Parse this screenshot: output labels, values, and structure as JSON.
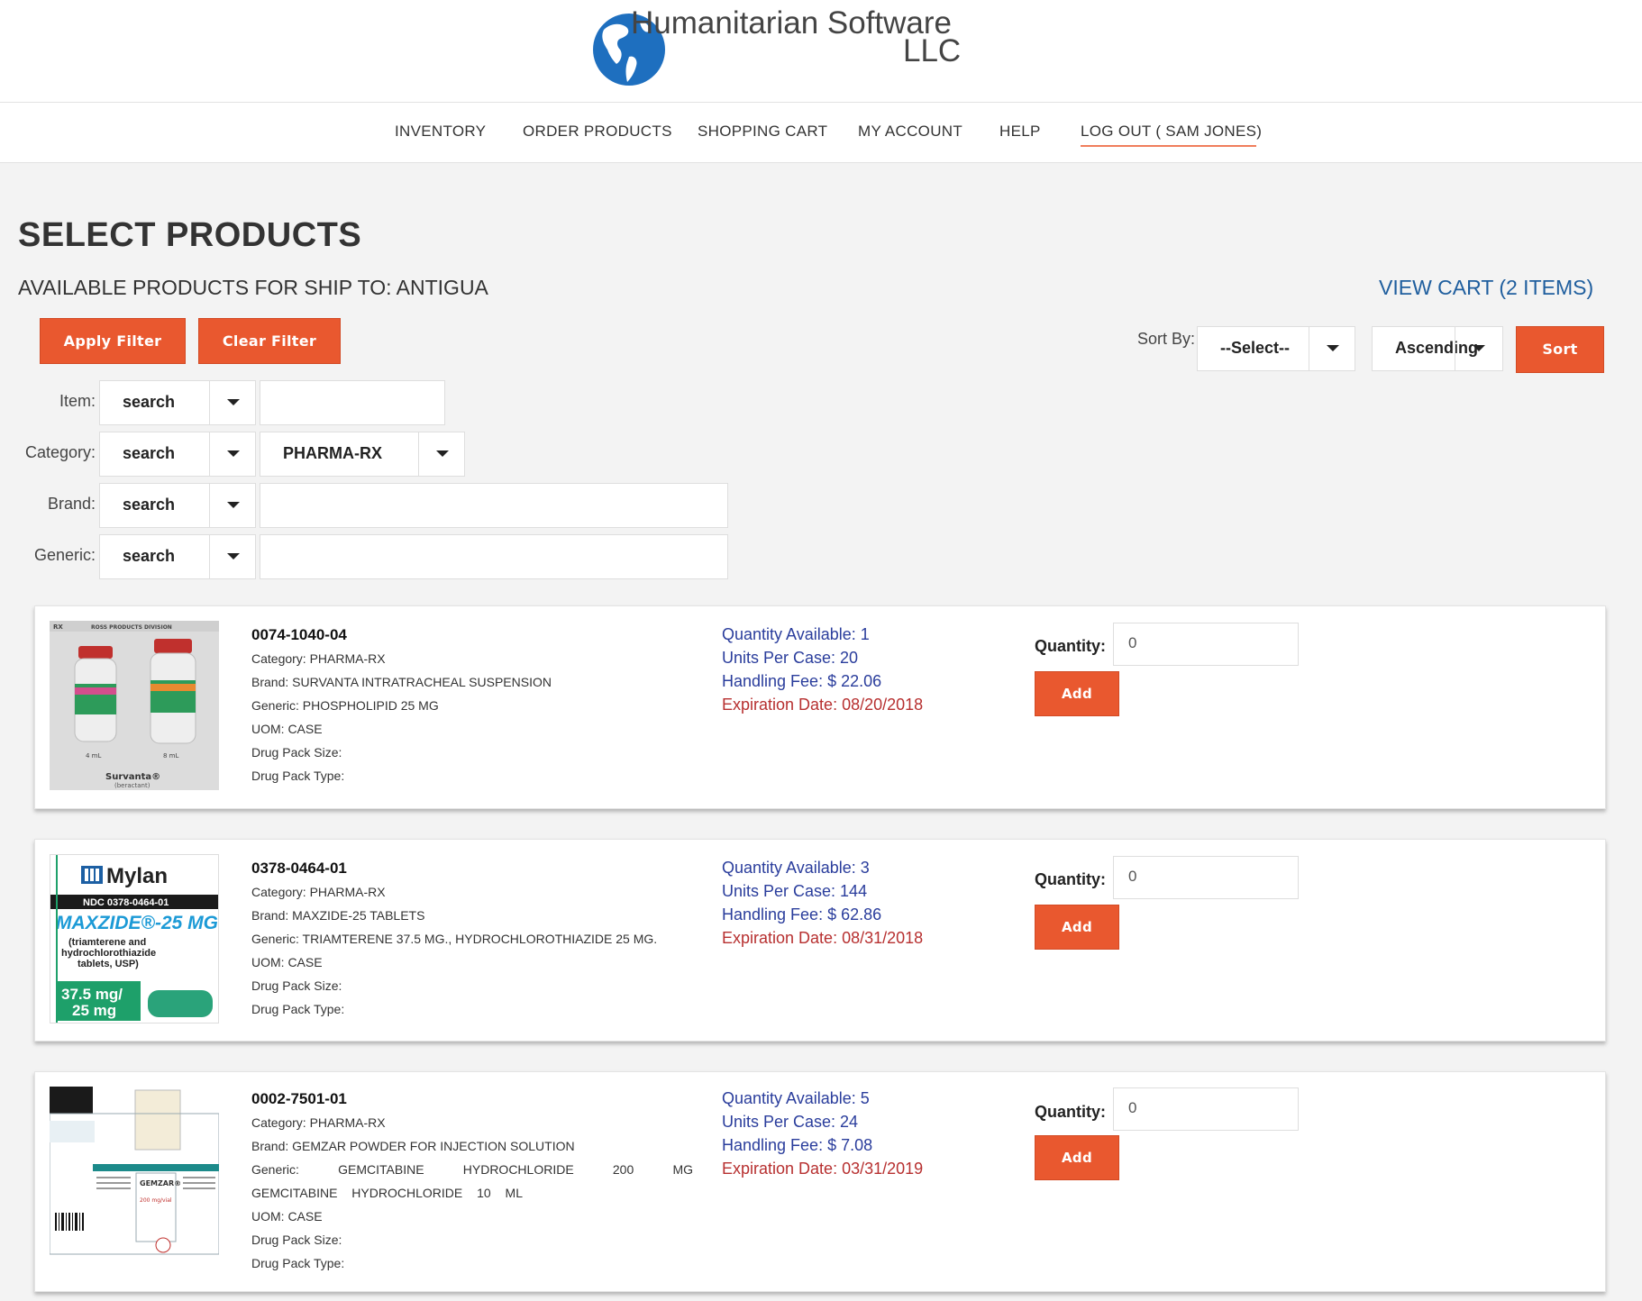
{
  "brand": {
    "line1": "Humanitarian Software",
    "line2": "LLC"
  },
  "nav": {
    "inventory": "INVENTORY",
    "order_products": "ORDER PRODUCTS",
    "shopping_cart": "SHOPPING CART",
    "my_account": "MY ACCOUNT",
    "help": "HELP",
    "logout": "LOG OUT ( SAM JONES)"
  },
  "page": {
    "title": "SELECT PRODUCTS",
    "subtitle": "AVAILABLE PRODUCTS FOR SHIP TO: ANTIGUA",
    "view_cart": "VIEW CART (2 ITEMS)"
  },
  "filters": {
    "apply_label": "Apply Filter",
    "clear_label": "Clear Filter",
    "item": {
      "label": "Item:",
      "mode": "search",
      "value": ""
    },
    "category": {
      "label": "Category:",
      "mode": "search",
      "value": "PHARMA-RX"
    },
    "brand": {
      "label": "Brand:",
      "mode": "search",
      "value": ""
    },
    "generic": {
      "label": "Generic:",
      "mode": "search",
      "value": ""
    }
  },
  "sort": {
    "label": "Sort By:",
    "field": "--Select--",
    "direction": "Ascending",
    "button": "Sort"
  },
  "products": [
    {
      "sku": "0074-1040-04",
      "category": "Category: PHARMA-RX",
      "brand": "Brand: SURVANTA INTRATRACHEAL SUSPENSION",
      "generic": "Generic: PHOSPHOLIPID 25 MG",
      "uom": "UOM: CASE",
      "pack_size": "Drug Pack Size:",
      "pack_type": "Drug Pack Type:",
      "qty_available": "Quantity Available: 1",
      "units_per_case": "Units Per Case: 20",
      "handling_fee": "Handling Fee: $ 22.06",
      "expiration": "Expiration Date: 08/20/2018",
      "qty_label": "Quantity:",
      "qty_value": "0",
      "add_label": "Add",
      "image": {
        "header_left": "RX",
        "header_right": "ROSS PRODUCTS DIVISION",
        "vial1": "4 mL",
        "vial2": "8 mL",
        "name": "Survanta®",
        "sub": "(beractant)"
      }
    },
    {
      "sku": "0378-0464-01",
      "category": "Category: PHARMA-RX",
      "brand": "Brand: MAXZIDE-25 TABLETS",
      "generic": "Generic: TRIAMTERENE 37.5 MG., HYDROCHLOROTHIAZIDE 25 MG.",
      "uom": "UOM: CASE",
      "pack_size": "Drug Pack Size:",
      "pack_type": "Drug Pack Type:",
      "qty_available": "Quantity Available: 3",
      "units_per_case": "Units Per Case: 144",
      "handling_fee": "Handling Fee: $ 62.86",
      "expiration": "Expiration Date: 08/31/2018",
      "qty_label": "Quantity:",
      "qty_value": "0",
      "add_label": "Add",
      "image": {
        "maker": "Mylan",
        "ndc": "NDC 0378-0464-01",
        "name": "MAXZIDE®-25 MG",
        "desc": "(triamterene and hydrochlorothiazide tablets, USP)",
        "dose1": "37.5 mg/",
        "dose2": "25 mg"
      }
    },
    {
      "sku": "0002-7501-01",
      "category": "Category: PHARMA-RX",
      "brand": "Brand: GEMZAR POWDER FOR INJECTION SOLUTION",
      "generic": "Generic: GEMCITABINE HYDROCHLORIDE 200 MG GEMCITABINE HYDROCHLORIDE 10 ML",
      "uom": "UOM: CASE",
      "pack_size": "Drug Pack Size:",
      "pack_type": "Drug Pack Type:",
      "qty_available": "Quantity Available: 5",
      "units_per_case": "Units Per Case: 24",
      "handling_fee": "Handling Fee: $ 7.08",
      "expiration": "Expiration Date: 03/31/2019",
      "qty_label": "Quantity:",
      "qty_value": "0",
      "add_label": "Add",
      "image": {
        "name": "GEMZAR®",
        "dose": "200 mg/vial"
      }
    }
  ],
  "colors": {
    "accent": "#e9582f",
    "link": "#1f5e9e",
    "stats": "#2a3d9c",
    "expiration": "#b73030"
  }
}
